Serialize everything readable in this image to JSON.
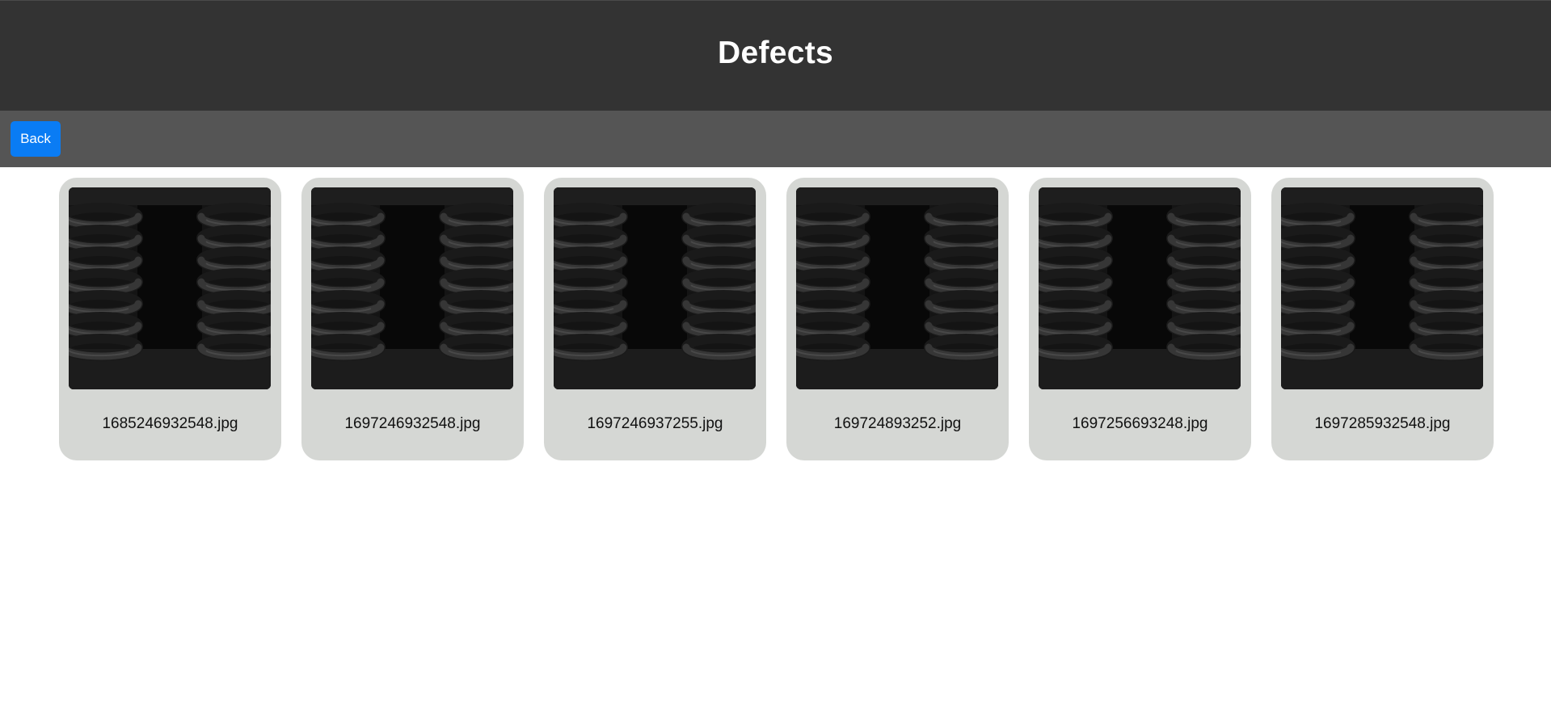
{
  "header": {
    "title": "Defects"
  },
  "toolbar": {
    "back_label": "Back"
  },
  "colors": {
    "header_bg": "#333333",
    "toolbar_bg": "#555555",
    "button_bg": "#0a7cf4",
    "card_bg": "#d5d7d4"
  },
  "gallery": {
    "thumbnail_icon": "coil-spring-photo",
    "items": [
      {
        "filename": "1685246932548.jpg"
      },
      {
        "filename": "1697246932548.jpg"
      },
      {
        "filename": "1697246937255.jpg"
      },
      {
        "filename": "169724893252.jpg"
      },
      {
        "filename": "1697256693248.jpg"
      },
      {
        "filename": "1697285932548.jpg"
      }
    ]
  }
}
